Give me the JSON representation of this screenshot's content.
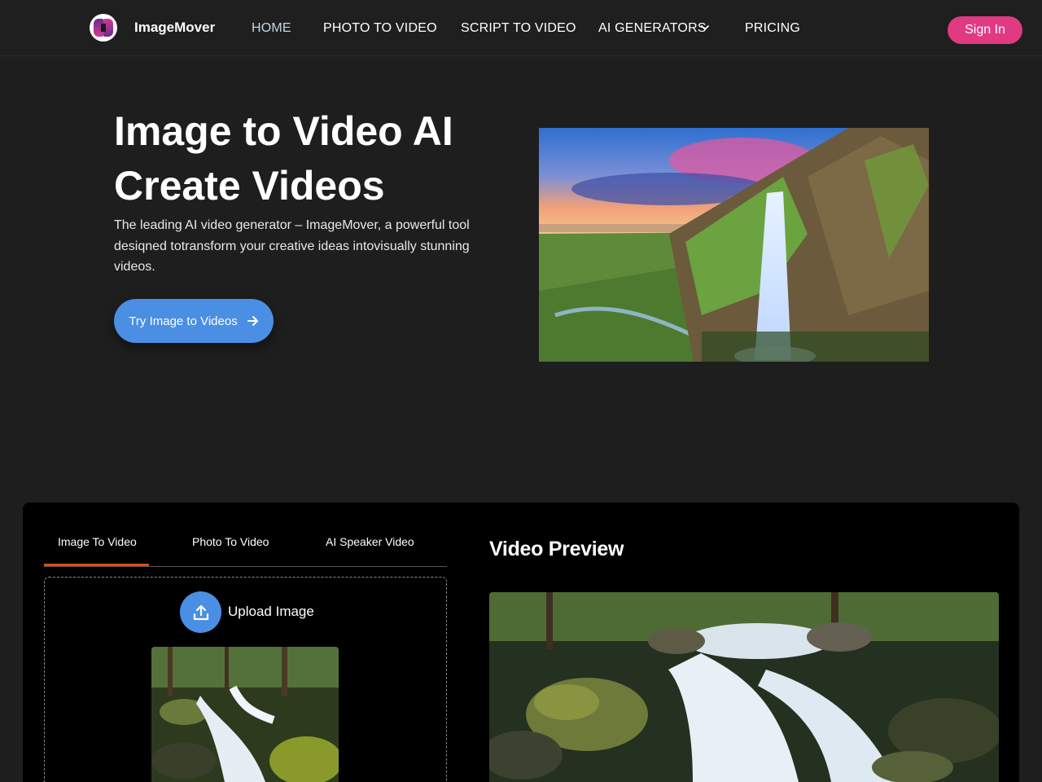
{
  "nav": {
    "brand": "ImageMover",
    "links": [
      "HOME",
      "PHOTO TO VIDEO",
      "SCRIPT TO VIDEO",
      "AI GENERATORS",
      "PRICING"
    ],
    "active": "HOME",
    "signin": "Sign In"
  },
  "hero": {
    "title_line1": "Image to Video AI",
    "title_line2": "Create Videos",
    "description": "The leading AI video generator – ImageMover, a powerful tool desiqned totransform your creative ideas intovisually stunning videos.",
    "cta": "Try Image to Videos"
  },
  "tool": {
    "tabs": [
      "Image To Video",
      "Photo To Video",
      "AI Speaker Video"
    ],
    "active_tab": "Image To Video",
    "upload_label": "Upload Image",
    "preview_title": "Video Preview"
  },
  "colors": {
    "accent_blue": "#4a8fe4",
    "signin_pink": "#e13a82",
    "tab_underline": "#e5481f"
  },
  "icons": [
    "logo-icon",
    "chevron-down-icon",
    "arrow-right-icon",
    "upload-icon"
  ]
}
